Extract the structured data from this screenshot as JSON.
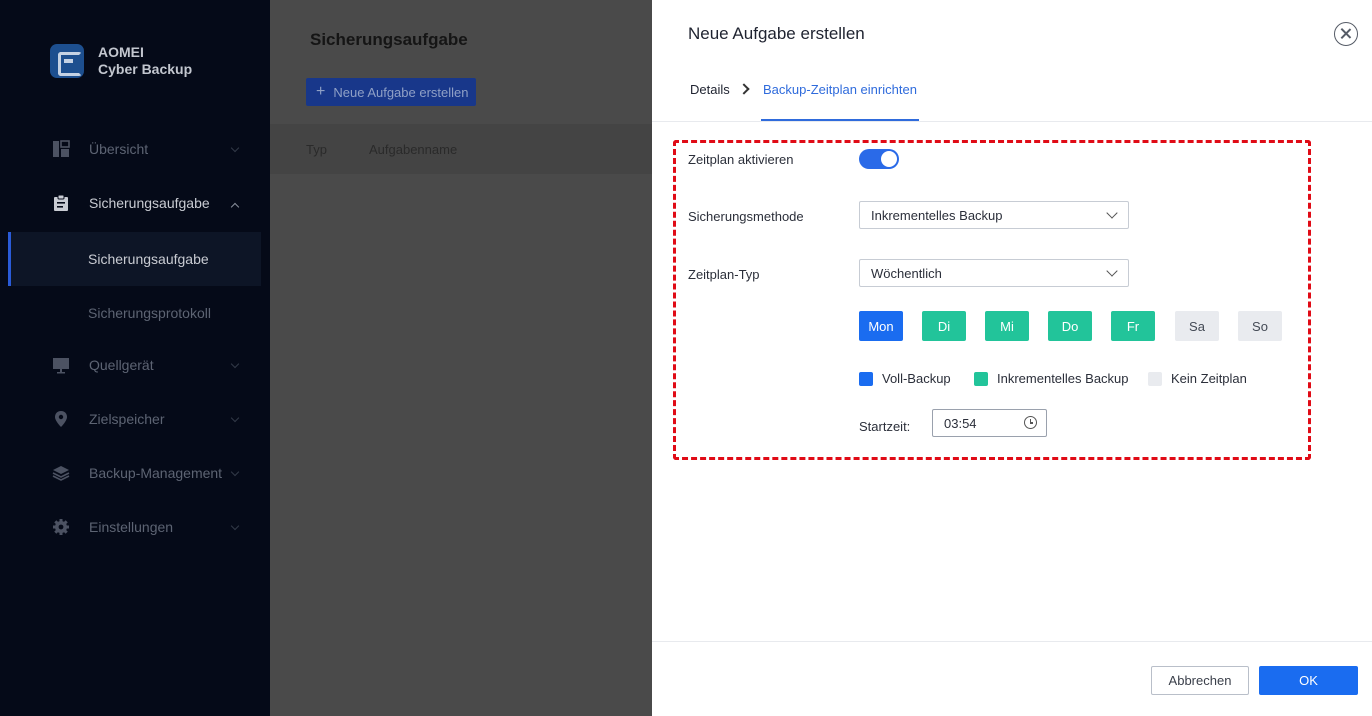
{
  "brand": {
    "line1": "AOMEI",
    "line2": "Cyber Backup"
  },
  "sidebar": {
    "items": [
      {
        "label": "Übersicht",
        "icon": "dashboard-icon"
      },
      {
        "label": "Sicherungsaufgabe",
        "icon": "clipboard-icon",
        "expanded": true
      },
      {
        "label": "Quellgerät",
        "icon": "monitor-icon"
      },
      {
        "label": "Zielspeicher",
        "icon": "location-pin-icon"
      },
      {
        "label": "Backup-Management",
        "icon": "layers-icon"
      },
      {
        "label": "Einstellungen",
        "icon": "gear-icon"
      }
    ],
    "sub_items": [
      {
        "label": "Sicherungsaufgabe",
        "selected": true
      },
      {
        "label": "Sicherungsprotokoll",
        "selected": false
      }
    ]
  },
  "main": {
    "title": "Sicherungsaufgabe",
    "new_task_button": "Neue Aufgabe erstellen",
    "columns": [
      "Typ",
      "Aufgabenname"
    ]
  },
  "dialog": {
    "title": "Neue Aufgabe erstellen",
    "steps": [
      "Details",
      "Backup-Zeitplan einrichten"
    ],
    "active_step": 1,
    "schedule_enable_label": "Zeitplan aktivieren",
    "schedule_enabled": true,
    "method_label": "Sicherungsmethode",
    "method_value": "Inkrementelles Backup",
    "type_label": "Zeitplan-Typ",
    "type_value": "Wöchentlich",
    "days": [
      {
        "label": "Mon",
        "mode": "full"
      },
      {
        "label": "Di",
        "mode": "incremental"
      },
      {
        "label": "Mi",
        "mode": "incremental"
      },
      {
        "label": "Do",
        "mode": "incremental"
      },
      {
        "label": "Fr",
        "mode": "incremental"
      },
      {
        "label": "Sa",
        "mode": "none"
      },
      {
        "label": "So",
        "mode": "none"
      }
    ],
    "legend": [
      {
        "label": "Voll-Backup",
        "color": "#1a6cf0"
      },
      {
        "label": "Inkrementelles Backup",
        "color": "#22c49a"
      },
      {
        "label": "Kein Zeitplan",
        "color": "#e9ebef"
      }
    ],
    "start_label": "Startzeit:",
    "start_time": "03:54",
    "cancel_label": "Abbrechen",
    "ok_label": "OK"
  },
  "colors": {
    "accent": "#1a6cf0",
    "incremental": "#22c49a",
    "highlight": "#e00b16"
  }
}
